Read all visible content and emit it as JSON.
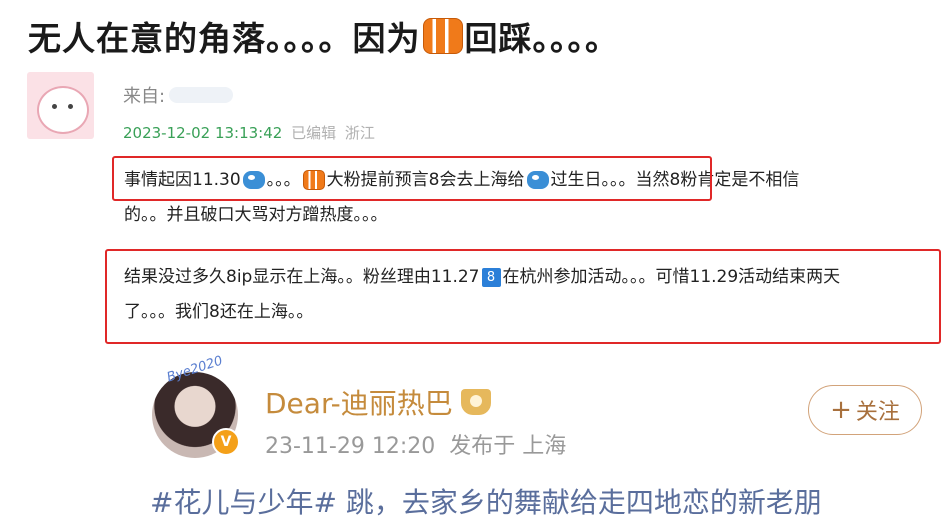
{
  "page_title": {
    "before": "无人在意的角落。。。。因为",
    "after": "回踩。。。。"
  },
  "post": {
    "from_label": "来自:",
    "timestamp": "2023-12-02 13:13:42",
    "edited": "已编辑",
    "location": "浙江",
    "p1": {
      "a": "事情起因11.30",
      "b": "。。。",
      "c": "大粉提前预言8会去上海给",
      "d": "过生日。。。当然8粉肯定是不相信"
    },
    "p1_line2": "的。。并且破口大骂对方蹭热度。。。",
    "p2": {
      "a": "结果没过多久8ip显示在上海。。粉丝理由11.27",
      "b": "在杭州参加活动。。。可惜11.29活动结束两天"
    },
    "p2_line2": "了。。。我们8还在上海。。"
  },
  "quoted": {
    "author": "Dear-迪丽热巴",
    "date": "23-11-29 12:20",
    "published_label": "发布于 上海",
    "follow_plus": "+",
    "follow_label": "关注",
    "avatar_deco": "Bye2020",
    "verified_badge": "V",
    "emoji_8": "8",
    "cut_text": "#花儿与少年# 跳，去家乡的舞献给走四地恋的新老朋"
  },
  "colors": {
    "timestamp": "#39a057",
    "highlight_box": "#e02828",
    "author": "#c58b3c",
    "follow_border": "#d2a37a"
  }
}
